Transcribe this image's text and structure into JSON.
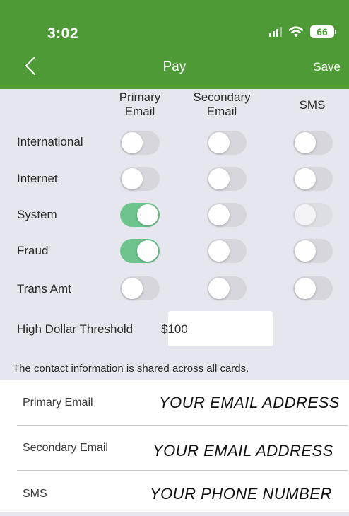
{
  "status_bar": {
    "time": "3:02",
    "battery": "66",
    "icons": [
      "cellular-signal-icon",
      "wifi-icon",
      "battery-icon"
    ]
  },
  "nav": {
    "back_icon": "chevron-left-icon",
    "title": "Pay",
    "save_label": "Save"
  },
  "colors": {
    "header": "#4e9a36",
    "background": "#e6e6ef",
    "toggle_on": "#6dc48d",
    "toggle_off": "#d6d6dc"
  },
  "columns": {
    "primary_email": "Primary\nEmail",
    "secondary_email": "Secondary\nEmail",
    "sms": "SMS"
  },
  "rows": [
    {
      "label": "International",
      "primary_email": false,
      "secondary_email": false,
      "sms": false
    },
    {
      "label": "Internet",
      "primary_email": false,
      "secondary_email": false,
      "sms": false
    },
    {
      "label": "System",
      "primary_email": true,
      "secondary_email": false,
      "sms": false,
      "sms_disabled": true
    },
    {
      "label": "Fraud",
      "primary_email": true,
      "secondary_email": false,
      "sms": false
    },
    {
      "label": "Trans Amt",
      "primary_email": false,
      "secondary_email": false,
      "sms": false
    }
  ],
  "threshold": {
    "label": "High Dollar Threshold",
    "value": "$100"
  },
  "info_note": "The contact information is shared across all cards.",
  "contacts": [
    {
      "label": "Primary Email",
      "value": "YOUR EMAIL ADDRESS"
    },
    {
      "label": "Secondary Email",
      "value": "YOUR EMAIL ADDRESS"
    },
    {
      "label": "SMS",
      "value": "YOUR PHONE NUMBER"
    }
  ]
}
